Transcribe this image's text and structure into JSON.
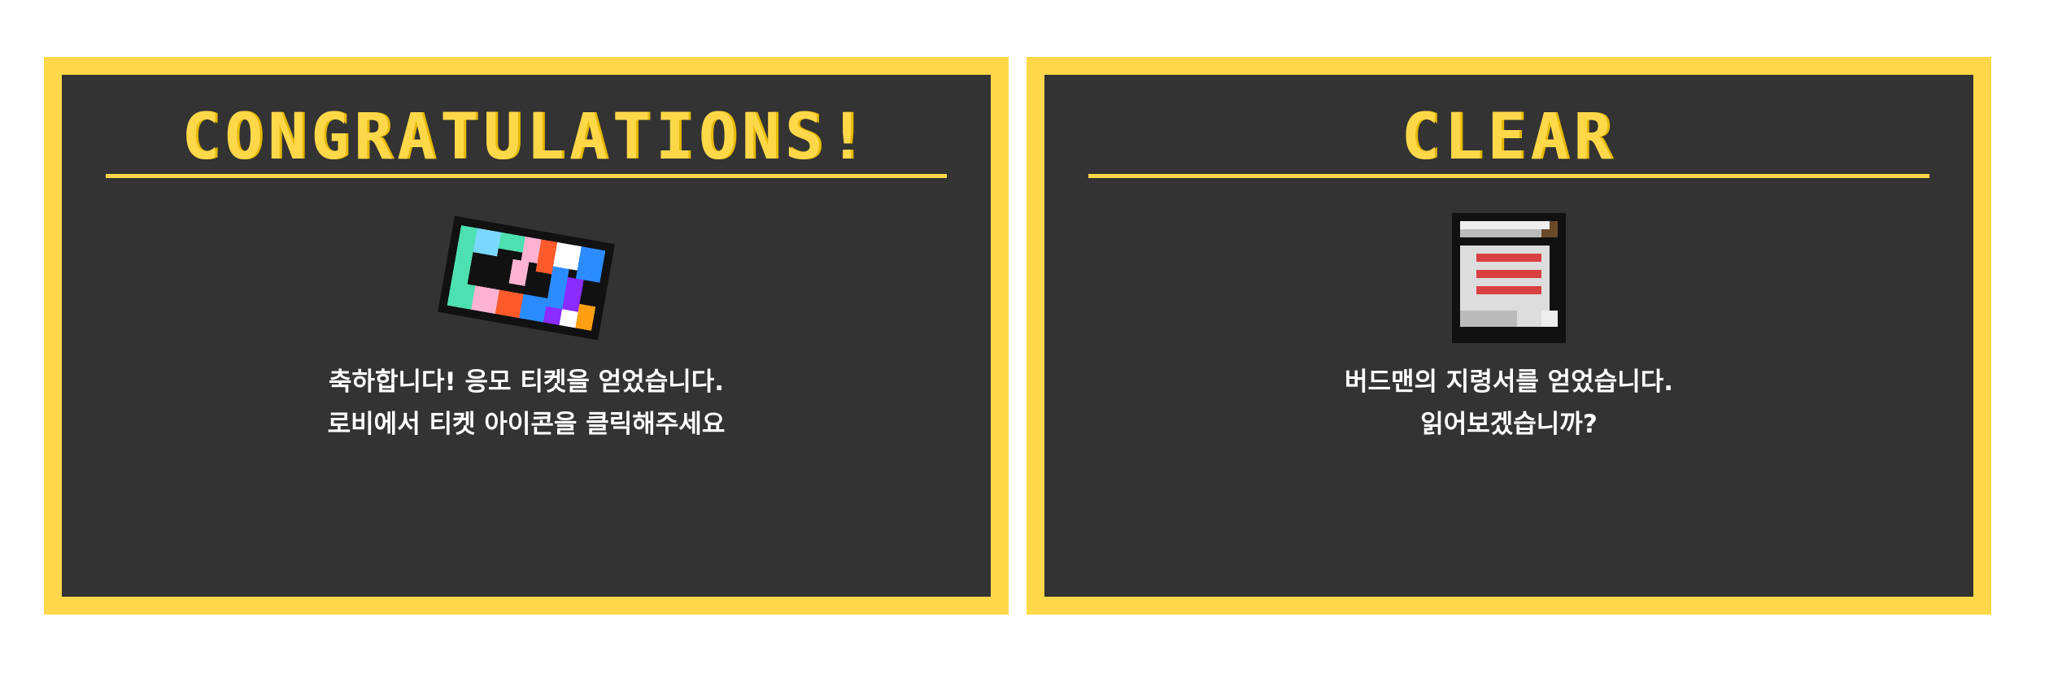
{
  "colors": {
    "frame": "#ffd84a",
    "panel_background": "#333333",
    "text": "#ffffff"
  },
  "panels": [
    {
      "title": "CONGRATULATIONS!",
      "icon": "ticket-icon",
      "message_lines": [
        "축하합니다! 응모 티켓을 얻었습니다.",
        "로비에서 티켓 아이콘을 클릭해주세요"
      ]
    },
    {
      "title": "CLEAR",
      "icon": "scroll-icon",
      "message_lines": [
        "버드맨의 지령서를 얻었습니다.",
        "읽어보겠습니까?"
      ]
    }
  ]
}
